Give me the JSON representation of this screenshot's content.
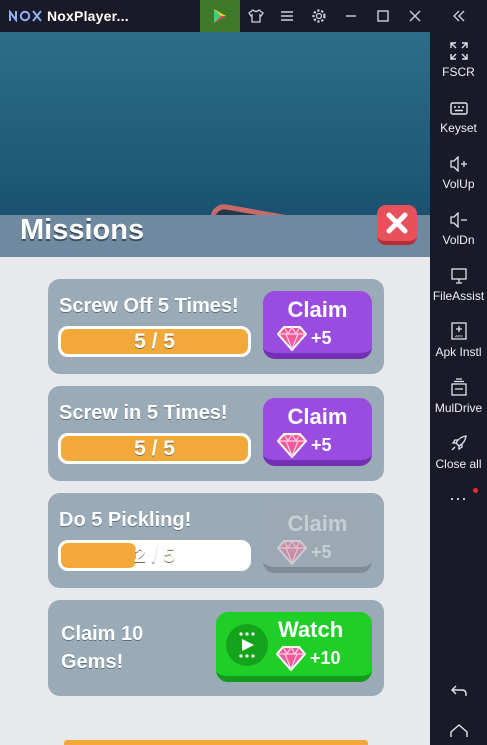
{
  "window": {
    "title": "NoxPlayer...",
    "logo_text": "nox"
  },
  "titlebar": {
    "icons": [
      "play-store-icon",
      "shirt-icon",
      "menu-icon",
      "gear-icon",
      "minimize-icon",
      "maximize-icon",
      "close-icon"
    ]
  },
  "sidebar": {
    "items": [
      {
        "label": "FSCR",
        "icon": "fullscreen-icon"
      },
      {
        "label": "Keyset",
        "icon": "keyboard-icon"
      },
      {
        "label": "VolUp",
        "icon": "volume-up-icon"
      },
      {
        "label": "VolDn",
        "icon": "volume-down-icon"
      },
      {
        "label": "FileAssist",
        "icon": "monitor-icon"
      },
      {
        "label": "Apk Instl",
        "icon": "apk-install-icon"
      },
      {
        "label": "MulDrive",
        "icon": "multi-drive-icon"
      },
      {
        "label": "Close all",
        "icon": "rocket-icon"
      }
    ],
    "more": "...",
    "bottom_icons": [
      "back-icon",
      "home-icon"
    ]
  },
  "game": {
    "title": "Missions",
    "missions": [
      {
        "title": "Screw Off 5 Times!",
        "progress_text": "5 / 5",
        "progress": 1.0,
        "button": "Claim",
        "reward": "+5",
        "enabled": true
      },
      {
        "title": "Screw in 5 Times!",
        "progress_text": "5 / 5",
        "progress": 1.0,
        "button": "Claim",
        "reward": "+5",
        "enabled": true
      },
      {
        "title": "Do 5 Pickling!",
        "progress_text": "2 / 5",
        "progress": 0.4,
        "button": "Claim",
        "reward": "+5",
        "enabled": false
      }
    ],
    "gems_mission": {
      "title_line1": "Claim 10",
      "title_line2": "Gems!",
      "button": "Watch",
      "reward": "+10"
    }
  },
  "colors": {
    "accent_orange": "#f2a93a",
    "claim_purple": "#9a4ce0",
    "watch_green": "#1fcf27",
    "close_red": "#e8505b"
  }
}
